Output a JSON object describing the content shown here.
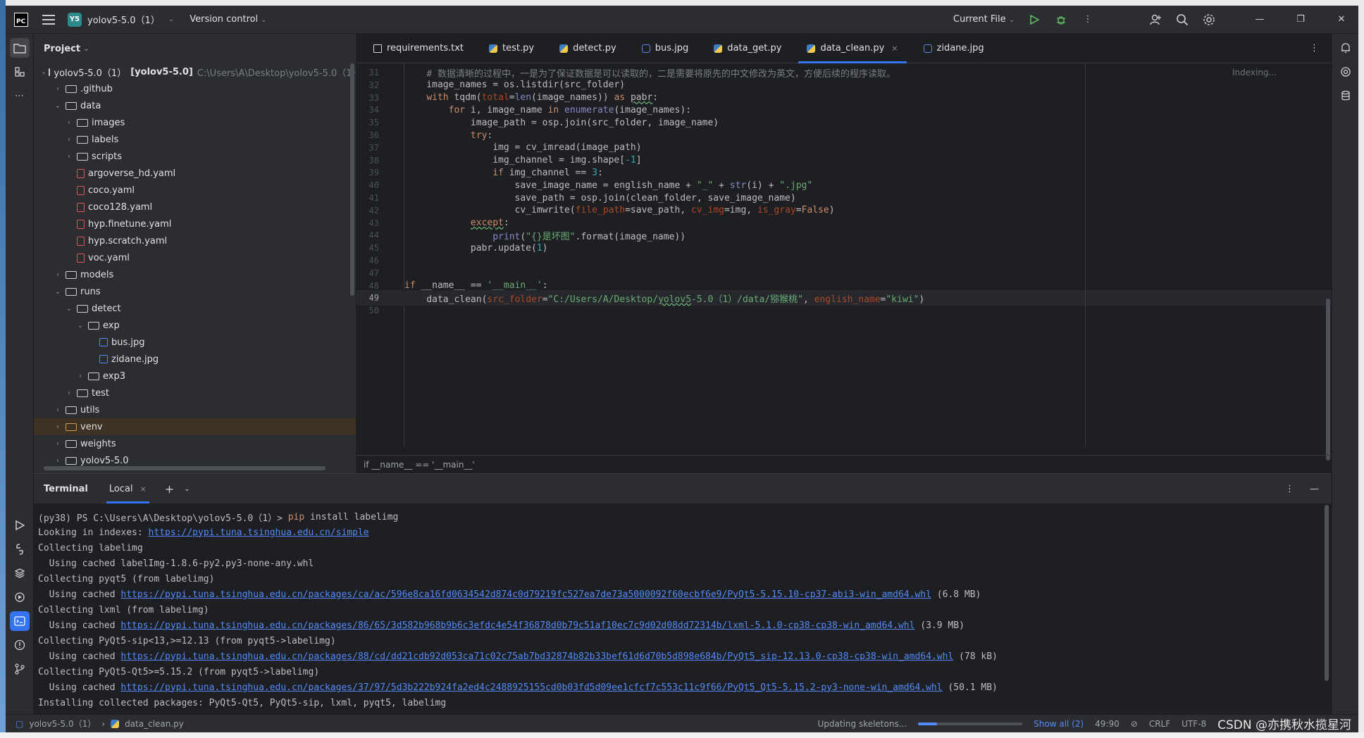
{
  "titlebar": {
    "logo": "PC",
    "project_badge": "Y5",
    "project_name": "yolov5-5.0（1）",
    "vcs": "Version control",
    "run_config": "Current File"
  },
  "project_panel": {
    "title": "Project",
    "rows": [
      {
        "label": "yolov5-5.0（1）",
        "bold": "[yolov5-5.0]",
        "path": "C:\\Users\\A\\Desktop\\yolov5-5.0（1）",
        "arrow": "⌄",
        "type": "folder",
        "indent": 0
      },
      {
        "label": ".github",
        "arrow": "›",
        "type": "folder",
        "indent": 1
      },
      {
        "label": "data",
        "arrow": "⌄",
        "type": "folder",
        "indent": 1
      },
      {
        "label": "images",
        "arrow": "›",
        "type": "folder",
        "indent": 2
      },
      {
        "label": "labels",
        "arrow": "›",
        "type": "folder",
        "indent": 2
      },
      {
        "label": "scripts",
        "arrow": "›",
        "type": "folder",
        "indent": 2
      },
      {
        "label": "argoverse_hd.yaml",
        "arrow": "",
        "type": "yaml",
        "indent": 2
      },
      {
        "label": "coco.yaml",
        "arrow": "",
        "type": "yaml",
        "indent": 2
      },
      {
        "label": "coco128.yaml",
        "arrow": "",
        "type": "yaml",
        "indent": 2
      },
      {
        "label": "hyp.finetune.yaml",
        "arrow": "",
        "type": "yaml",
        "indent": 2
      },
      {
        "label": "hyp.scratch.yaml",
        "arrow": "",
        "type": "yaml",
        "indent": 2
      },
      {
        "label": "voc.yaml",
        "arrow": "",
        "type": "yaml",
        "indent": 2
      },
      {
        "label": "models",
        "arrow": "›",
        "type": "folder",
        "indent": 1
      },
      {
        "label": "runs",
        "arrow": "⌄",
        "type": "folder",
        "indent": 1
      },
      {
        "label": "detect",
        "arrow": "⌄",
        "type": "folder",
        "indent": 2
      },
      {
        "label": "exp",
        "arrow": "⌄",
        "type": "folder",
        "indent": 3
      },
      {
        "label": "bus.jpg",
        "arrow": "",
        "type": "img",
        "indent": 4
      },
      {
        "label": "zidane.jpg",
        "arrow": "",
        "type": "img",
        "indent": 4
      },
      {
        "label": "exp3",
        "arrow": "›",
        "type": "folder",
        "indent": 3
      },
      {
        "label": "test",
        "arrow": "›",
        "type": "folder",
        "indent": 2
      },
      {
        "label": "utils",
        "arrow": "›",
        "type": "folder",
        "indent": 1
      },
      {
        "label": "venv",
        "arrow": "›",
        "type": "folder",
        "indent": 1,
        "selected": true
      },
      {
        "label": "weights",
        "arrow": "›",
        "type": "folder",
        "indent": 1
      },
      {
        "label": "yolov5-5.0",
        "arrow": "›",
        "type": "folder",
        "indent": 1
      }
    ]
  },
  "editor": {
    "tabs": [
      {
        "label": "requirements.txt",
        "icon": "txt"
      },
      {
        "label": "test.py",
        "icon": "py"
      },
      {
        "label": "detect.py",
        "icon": "py"
      },
      {
        "label": "bus.jpg",
        "icon": "img"
      },
      {
        "label": "data_get.py",
        "icon": "py"
      },
      {
        "label": "data_clean.py",
        "icon": "py",
        "active": true,
        "close": "×"
      },
      {
        "label": "zidane.jpg",
        "icon": "img"
      }
    ],
    "indexing": "Indexing...",
    "current_line": "49",
    "breadcrumb": "if __name__ == '__main__'",
    "lines": [
      {
        "n": "31",
        "html": "    <span class=\"cmt\"># 数据清晰的过程中，一是为了保证数据是可以读取的，二是需要将原先的中文修改为英文，方便后续的程序读取。</span>"
      },
      {
        "n": "32",
        "html": "    image_names = os.listdir(src_folder)"
      },
      {
        "n": "33",
        "html": "    <span class=\"kw\">with</span> tqdm(<span class=\"prm\">total</span>=<span class=\"bi\">len</span>(image_names)) <span class=\"kw\">as</span> <span class=\"und\">pabr</span>:"
      },
      {
        "n": "34",
        "html": "        <span class=\"kw\">for</span> i, image_name <span class=\"kw\">in</span> <span class=\"bi\">enumerate</span>(image_names):"
      },
      {
        "n": "35",
        "html": "            image_path = osp.join(src_folder, image_name)"
      },
      {
        "n": "36",
        "html": "            <span class=\"kw\">try</span>:"
      },
      {
        "n": "37",
        "html": "                img = cv_imread(image_path)"
      },
      {
        "n": "38",
        "html": "                img_channel = img.shape[<span class=\"numc\">-1</span>]"
      },
      {
        "n": "39",
        "html": "                <span class=\"kw\">if</span> img_channel == <span class=\"numc\">3</span>:"
      },
      {
        "n": "40",
        "html": "                    save_image_name = english_name + <span class=\"str\">\"_\"</span> + <span class=\"bi\">str</span>(i) + <span class=\"str\">\".jpg\"</span>"
      },
      {
        "n": "41",
        "html": "                    save_path = osp.join(clean_folder, save_image_name)"
      },
      {
        "n": "42",
        "html": "                    cv_imwrite(<span class=\"prm\">file_path</span>=save_path, <span class=\"prm\">cv_img</span>=img, <span class=\"prm\">is_gray</span>=<span class=\"kw\">False</span>)"
      },
      {
        "n": "43",
        "html": "            <span class=\"kw und\">except</span>:"
      },
      {
        "n": "44",
        "html": "                <span class=\"bi\">print</span>(<span class=\"str\">\"{}是坏图\"</span>.format(image_name))"
      },
      {
        "n": "45",
        "html": "            pabr.update(<span class=\"numc\">1</span>)"
      },
      {
        "n": "46",
        "html": ""
      },
      {
        "n": "47",
        "html": ""
      },
      {
        "n": "48",
        "html": "<span class=\"kw\">if</span> __name__ == <span class=\"str\">'__main__'</span>:"
      },
      {
        "n": "49",
        "html": "    data_clean(<span class=\"prm\">src_folder</span>=<span class=\"str\">\"C:/Users/A/Desktop/<span class=\"und\">yolov5</span>-5.0（1）/data/猕猴桃\"</span>, <span class=\"prm\">english_name</span>=<span class=\"str\">\"kiwi\"</span>)",
        "cur": true
      },
      {
        "n": "50",
        "html": ""
      }
    ]
  },
  "terminal": {
    "title": "Terminal",
    "tab": "Local",
    "tab_close": "×",
    "lines": [
      {
        "text": "(py38) PS C:\\Users\\A\\Desktop\\yolov5-5.0（1）> ",
        "cmd": "pip",
        "rest": " install labelimg"
      },
      {
        "text": "Looking in indexes: ",
        "link": "https://pypi.tuna.tsinghua.edu.cn/simple"
      },
      {
        "text": "Collecting labelimg"
      },
      {
        "text": "  Using cached labelImg-1.8.6-py2.py3-none-any.whl"
      },
      {
        "text": "Collecting pyqt5 (from labelimg)"
      },
      {
        "text": "  Using cached ",
        "link": "https://pypi.tuna.tsinghua.edu.cn/packages/ca/ac/596e8ca16fd0634542d874c0d79219fc527ea7de73a5000092f60ecbf6e9/PyQt5-5.15.10-cp37-abi3-win_amd64.whl",
        "rest": " (6.8 MB)"
      },
      {
        "text": "Collecting lxml (from labelimg)"
      },
      {
        "text": "  Using cached ",
        "link": "https://pypi.tuna.tsinghua.edu.cn/packages/86/65/3d582b968b9b6c3efdc4e54f36878d0b79c51af10ec7c9d02d08dd72314b/lxml-5.1.0-cp38-cp38-win_amd64.whl",
        "rest": " (3.9 MB)"
      },
      {
        "text": "Collecting PyQt5-sip<13,>=12.13 (from pyqt5->labelimg)"
      },
      {
        "text": "  Using cached ",
        "link": "https://pypi.tuna.tsinghua.edu.cn/packages/88/cd/dd21cdb92d053ca71c02c75ab7bd32874b82b33bef61d6d70b5d898e684b/PyQt5_sip-12.13.0-cp38-cp38-win_amd64.whl",
        "rest": " (78 kB)"
      },
      {
        "text": "Collecting PyQt5-Qt5>=5.15.2 (from pyqt5->labelimg)"
      },
      {
        "text": "  Using cached ",
        "link": "https://pypi.tuna.tsinghua.edu.cn/packages/37/97/5d3b222b924fa2ed4c2488925155cd0b03fd5d09ee1cfcf7c553c11c9f66/PyQt5_Qt5-5.15.2-py3-none-win_amd64.whl",
        "rest": " (50.1 MB)"
      },
      {
        "text": "Installing collected packages: PyQt5-Qt5, PyQt5-sip, lxml, pyqt5, labelimg"
      }
    ]
  },
  "statusbar": {
    "project": "yolov5-5.0（1）",
    "file": "data_clean.py",
    "task": "Updating skeletons...",
    "task_progress": 0.18,
    "show_all": "Show all (2)",
    "position": "49:90",
    "line_sep": "CRLF",
    "encoding": "UTF-8",
    "watermark": "CSDN @亦携秋水揽星河"
  },
  "colors": {
    "accent": "#3574f0",
    "link": "#548af7"
  }
}
